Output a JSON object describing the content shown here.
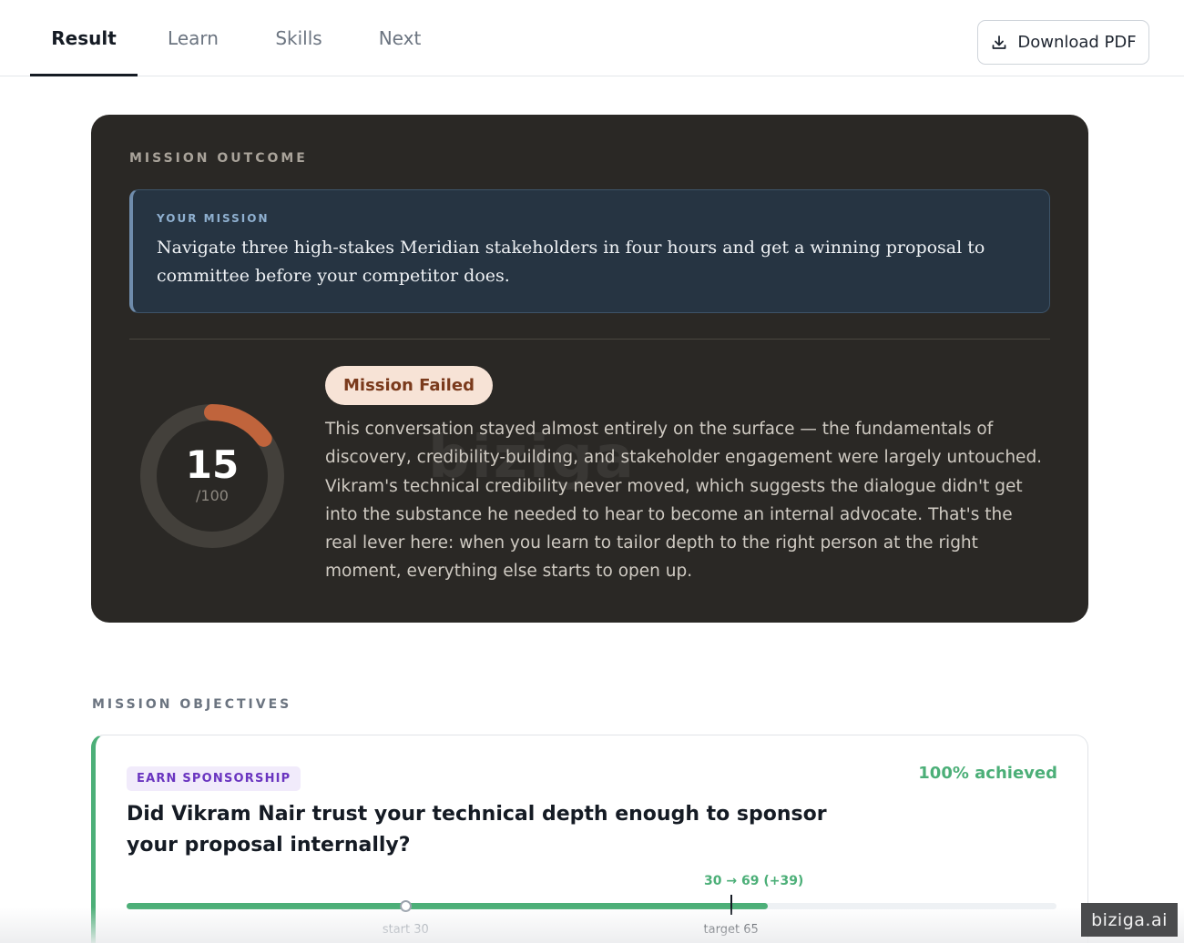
{
  "tabs": [
    {
      "label": "Result",
      "active": true
    },
    {
      "label": "Learn",
      "active": false
    },
    {
      "label": "Skills",
      "active": false
    },
    {
      "label": "Next",
      "active": false
    }
  ],
  "download_button": {
    "label": "Download PDF",
    "icon": "download-icon"
  },
  "outcome": {
    "section_label": "MISSION OUTCOME",
    "mission_label": "YOUR MISSION",
    "mission_text": "Navigate three high-stakes Meridian stakeholders in four hours and get a winning proposal to committee before your competitor does.",
    "score": "15",
    "score_max": "/100",
    "score_fraction": 0.15,
    "status_badge": "Mission Failed",
    "summary": "This conversation stayed almost entirely on the surface — the fundamentals of discovery, credibility-building, and stakeholder engagement were largely untouched. Vikram's technical credibility never moved, which suggests the dialogue didn't get into the substance he needed to hear to become an internal advocate. That's the real lever here: when you learn to tailor depth to the right person at the right moment, everything else starts to open up.",
    "watermark": "biziga"
  },
  "objectives": {
    "section_label": "MISSION OBJECTIVES",
    "items": [
      {
        "tag": "EARN SPONSORSHIP",
        "achieved": "100% achieved",
        "question": "Did Vikram Nair trust your technical depth enough to sponsor your proposal internally?",
        "delta": "30 → 69 (+39)",
        "start": 30,
        "current": 69,
        "target": 65,
        "scale_max": 100,
        "start_label": "start 30",
        "target_label": "target 65"
      }
    ]
  },
  "brand": "biziga.ai",
  "colors": {
    "accent_green": "#4caf78",
    "score_arc": "#c0643c",
    "card_dark": "#2a2825",
    "tag_purple": "#6a35c0"
  }
}
